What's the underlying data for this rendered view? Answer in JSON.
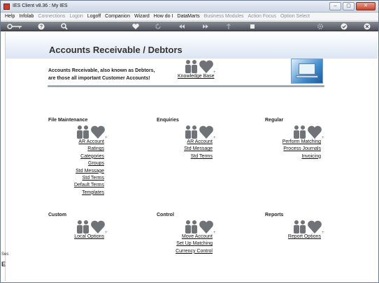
{
  "window": {
    "title": "IES Client v8.36 : My IES",
    "buttons": {
      "minimize": "–",
      "maximize": "▢",
      "close": "✕"
    }
  },
  "menubar": {
    "items": [
      {
        "label": "Help",
        "enabled": true
      },
      {
        "label": "Infolab",
        "enabled": true
      },
      {
        "label": "Connections",
        "enabled": false
      },
      {
        "label": "Logon",
        "enabled": false
      },
      {
        "label": "Logoff",
        "enabled": true
      },
      {
        "label": "Companion",
        "enabled": true
      },
      {
        "label": "Wizard",
        "enabled": true
      },
      {
        "label": "How do I",
        "enabled": true
      },
      {
        "label": "DataMarts",
        "enabled": true
      },
      {
        "label": "Business Modules",
        "enabled": false
      },
      {
        "label": "Action Focus",
        "enabled": false
      },
      {
        "label": "Option Select",
        "enabled": false
      }
    ]
  },
  "toolbar": {
    "icons": [
      "key-icon",
      "help-icon",
      "search-icon",
      "heart-icon",
      "refresh-icon",
      "rewind-icon",
      "forward-icon",
      "upload-icon",
      "stop-icon",
      "gear-icon",
      "check-icon",
      "close-icon"
    ]
  },
  "page": {
    "title": "Accounts Receivable / Debtors",
    "intro_line1": "Accounts Receivable, also known as Debtors,",
    "intro_line2": "are those  all important Customer Accounts!",
    "knowledge_base": "Knowledge Base"
  },
  "sections": {
    "file_maintenance": {
      "title": "File Maintenance",
      "links": [
        "AR Account",
        "Ratings",
        "Categories",
        "Groups",
        "Std Message",
        "Std Terms",
        "Default Terms",
        "Templates"
      ]
    },
    "enquiries": {
      "title": "Enquiries",
      "links": [
        "AR Account",
        "Std Message",
        "Std Terms"
      ]
    },
    "regular": {
      "title": "Regular",
      "links": [
        "Perform Matching",
        "Process Journals",
        "Invoicing"
      ]
    },
    "custom": {
      "title": "Custom",
      "links": [
        "Local Options"
      ]
    },
    "control": {
      "title": "Control",
      "links": [
        "Move Account",
        "Set Up Matching",
        "Currency Control"
      ]
    },
    "reports": {
      "title": "Reports",
      "links": [
        "Report Options"
      ]
    }
  },
  "left_strip": {
    "label1": "Ses",
    "label2": "E"
  },
  "colors": {
    "toolbar": "#5f646b",
    "banner": "#dbe5f3",
    "icon_gray": "#6f7378"
  }
}
